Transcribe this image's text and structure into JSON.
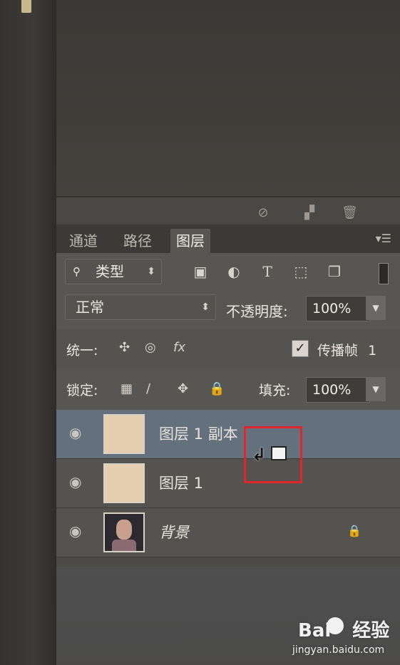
{
  "tabs": [
    "通道",
    "路径",
    "图层"
  ],
  "filter": {
    "type_label": "类型",
    "icons": [
      "image-filter-icon",
      "adjustment-filter-icon",
      "type-filter-icon",
      "shape-filter-icon",
      "smart-object-filter-icon"
    ]
  },
  "blend": {
    "mode": "正常",
    "opacity_label": "不透明度:",
    "opacity_value": "100%"
  },
  "unify": {
    "label": "统一:",
    "propagate_label": "传播帧",
    "propagate_value": "1",
    "propagate_checked": true
  },
  "lock": {
    "label": "锁定:",
    "fill_label": "填充:",
    "fill_value": "100%"
  },
  "layers": [
    {
      "name": "图层 1 副本",
      "selected": true,
      "thumb": "skin"
    },
    {
      "name": "图层 1",
      "selected": false,
      "thumb": "skin"
    },
    {
      "name": "背景",
      "selected": false,
      "thumb": "portrait",
      "locked": true
    }
  ],
  "watermark": {
    "brand": "Bai",
    "suffix": "经验",
    "url": "jingyan.baidu.com"
  }
}
